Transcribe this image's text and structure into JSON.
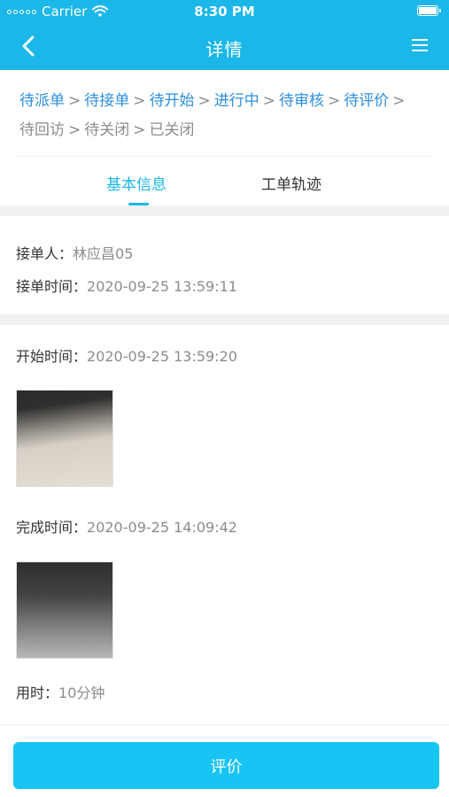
{
  "status_bar": {
    "carrier": "Carrier",
    "time": "8:30 PM"
  },
  "nav": {
    "title": "详情"
  },
  "steps": [
    {
      "label": "待派单",
      "state": "active"
    },
    {
      "label": "待接单",
      "state": "active"
    },
    {
      "label": "待开始",
      "state": "active"
    },
    {
      "label": "进行中",
      "state": "active"
    },
    {
      "label": "待审核",
      "state": "active"
    },
    {
      "label": "待评价",
      "state": "active"
    },
    {
      "label": "待回访",
      "state": "inactive"
    },
    {
      "label": "待关闭",
      "state": "inactive"
    },
    {
      "label": "已关闭",
      "state": "inactive"
    }
  ],
  "step_separator": ">",
  "tabs": {
    "basic": "基本信息",
    "track": "工单轨迹"
  },
  "accept": {
    "receiver_label": "接单人：",
    "receiver_value": "林应昌05",
    "time_label": "接单时间：",
    "time_value": "2020-09-25 13:59:11"
  },
  "progress": {
    "start_label": "开始时间：",
    "start_value": "2020-09-25 13:59:20",
    "finish_label": "完成时间：",
    "finish_value": "2020-09-25 14:09:42",
    "duration_label": "用时：",
    "duration_value": "10分钟"
  },
  "footer": {
    "evaluate_label": "评价"
  },
  "colors": {
    "primary": "#1ab7e8",
    "step_active": "#2b8fe0",
    "button": "#17c4f3"
  }
}
